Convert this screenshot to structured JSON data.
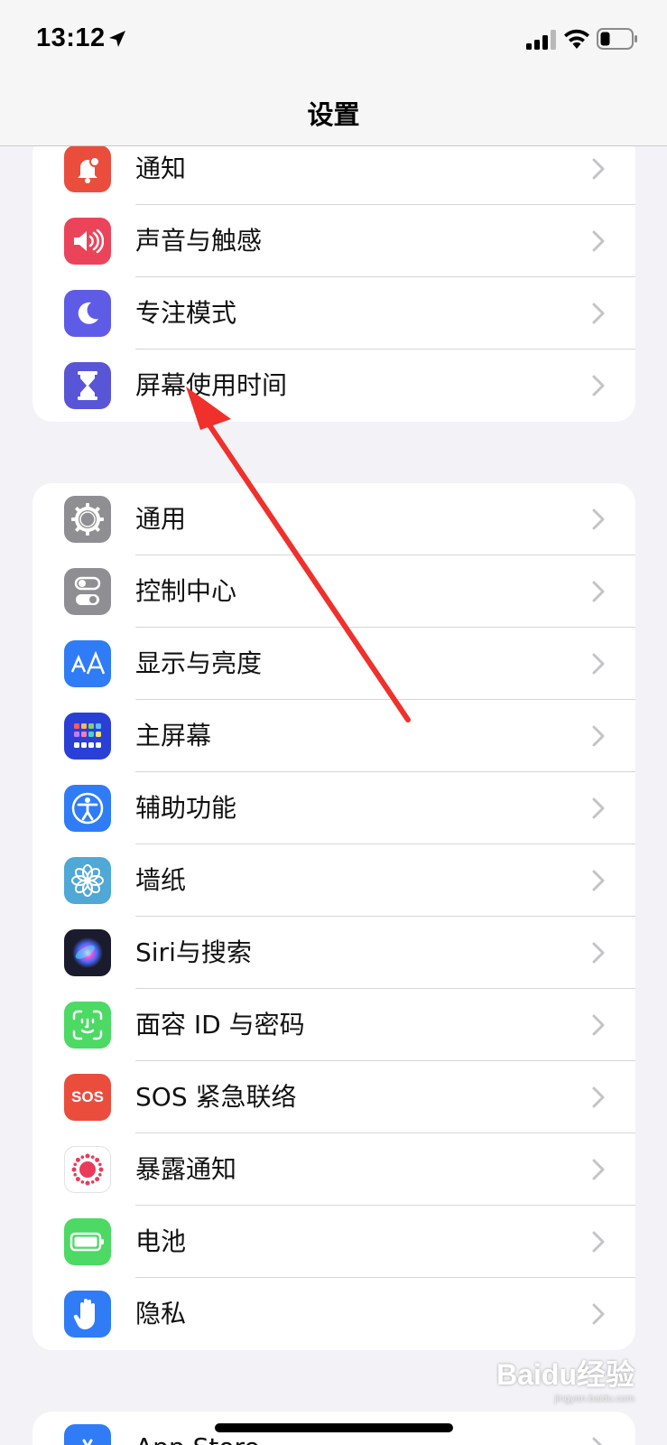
{
  "status_bar": {
    "time": "13:12"
  },
  "nav": {
    "title": "设置"
  },
  "groups": [
    {
      "items": [
        {
          "label": "通知",
          "icon": "bell-icon",
          "color": "#eb4d3d"
        },
        {
          "label": "声音与触感",
          "icon": "speaker-icon",
          "color": "#eb445a"
        },
        {
          "label": "专注模式",
          "icon": "moon-icon",
          "color": "#5e5ce6"
        },
        {
          "label": "屏幕使用时间",
          "icon": "hourglass-icon",
          "color": "#5856d6"
        }
      ]
    },
    {
      "items": [
        {
          "label": "通用",
          "icon": "gear-icon",
          "color": "#8e8e93"
        },
        {
          "label": "控制中心",
          "icon": "toggles-icon",
          "color": "#8e8e93"
        },
        {
          "label": "显示与亮度",
          "icon": "text-size-icon",
          "color": "#2f7cf6"
        },
        {
          "label": "主屏幕",
          "icon": "home-grid-icon",
          "color": "#2a3fd6"
        },
        {
          "label": "辅助功能",
          "icon": "accessibility-icon",
          "color": "#2f7cf6"
        },
        {
          "label": "墙纸",
          "icon": "flower-icon",
          "color": "#4fa8d6"
        },
        {
          "label": "Siri与搜索",
          "icon": "siri-icon",
          "color": "#1b1b2e"
        },
        {
          "label": "面容 ID 与密码",
          "icon": "face-id-icon",
          "color": "#4cd964"
        },
        {
          "label": "SOS 紧急联络",
          "icon": "sos-icon",
          "color": "#eb4d3d",
          "icon_text": "SOS"
        },
        {
          "label": "暴露通知",
          "icon": "exposure-icon",
          "color": "#ffffff"
        },
        {
          "label": "电池",
          "icon": "battery-icon",
          "color": "#4cd964"
        },
        {
          "label": "隐私",
          "icon": "hand-icon",
          "color": "#2f7cf6"
        }
      ]
    },
    {
      "items": [
        {
          "label": "App Store",
          "icon": "app-store-icon",
          "color": "#2f7cf6"
        }
      ]
    }
  ],
  "watermark": {
    "brand": "Baidu经验",
    "site": "jingyan.baidu.com"
  }
}
